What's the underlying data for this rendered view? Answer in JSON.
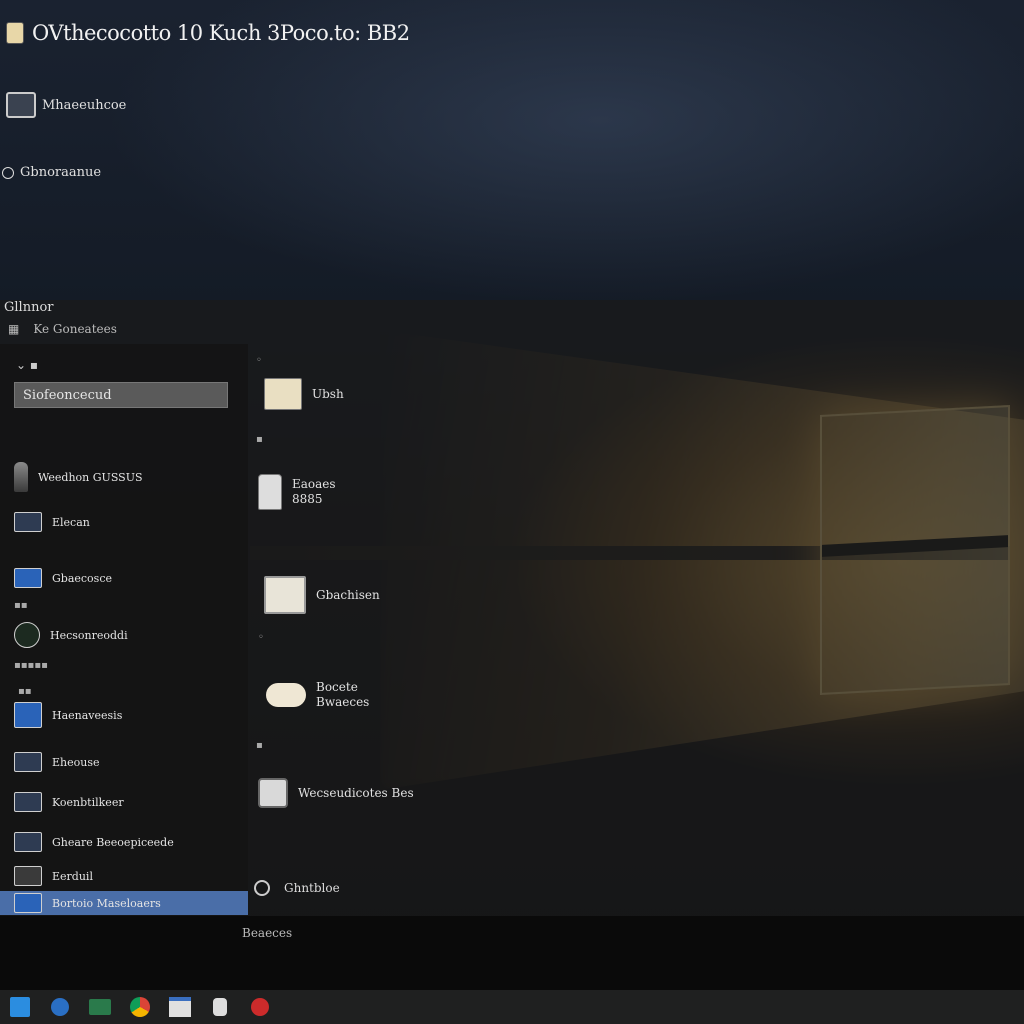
{
  "window": {
    "title": "OVthecocotto 10 Kuch 3Poco.to: BB2",
    "icon": "app-icon"
  },
  "desktop": {
    "items": [
      {
        "label": "Mhaeeuhcoe",
        "icon": "monitor-icon"
      },
      {
        "label": "Gbnoraanue",
        "icon": "circle-icon"
      }
    ]
  },
  "start_menu": {
    "header": "Gllnnor",
    "subheader": "Ke Goneatees",
    "search_value": "Siofeoncecud",
    "left_items": [
      {
        "label": "Weedhon GUSSUS",
        "icon": "person-icon"
      },
      {
        "label": "Elecan",
        "icon": "monitor-icon"
      },
      {
        "label": "Gbaecosce",
        "icon": "flag-icon"
      },
      {
        "label": "Hecsonreoddi",
        "icon": "circle-icon"
      },
      {
        "label": "Haenaveesis",
        "icon": "window-icon"
      },
      {
        "label": "Eheouse",
        "icon": "folder-icon"
      },
      {
        "label": "Koenbtilkeer",
        "icon": "grid-icon"
      },
      {
        "label": "Gheare Beeoepiceede",
        "icon": "calendar-icon"
      },
      {
        "label": "Eerduil",
        "icon": "mail-icon"
      },
      {
        "label": "Bortoio Maseloaers",
        "icon": "user-icon"
      }
    ],
    "tiles": [
      {
        "label": "Ubsh",
        "icon": "files-icon"
      },
      {
        "label": "Eaoaes",
        "label2": "8885",
        "icon": "document-icon"
      },
      {
        "label": "Gbachisen",
        "icon": "printer-icon"
      },
      {
        "label": "Bocete",
        "label2": "Bwaeces",
        "icon": "cloud-icon"
      },
      {
        "label": "Wecseudicotes Bes",
        "icon": "chip-icon"
      }
    ],
    "power_label": "Ghntbloe",
    "bottom_label": "Beaeces"
  },
  "taskbar": {
    "icons": [
      "start-icon",
      "edge-icon",
      "store-icon",
      "chrome-icon",
      "explorer-icon",
      "lock-icon",
      "record-icon"
    ]
  },
  "colors": {
    "accent": "#4a6ea8",
    "glow": "#ffd27a",
    "taskbar": "#1f2020"
  }
}
